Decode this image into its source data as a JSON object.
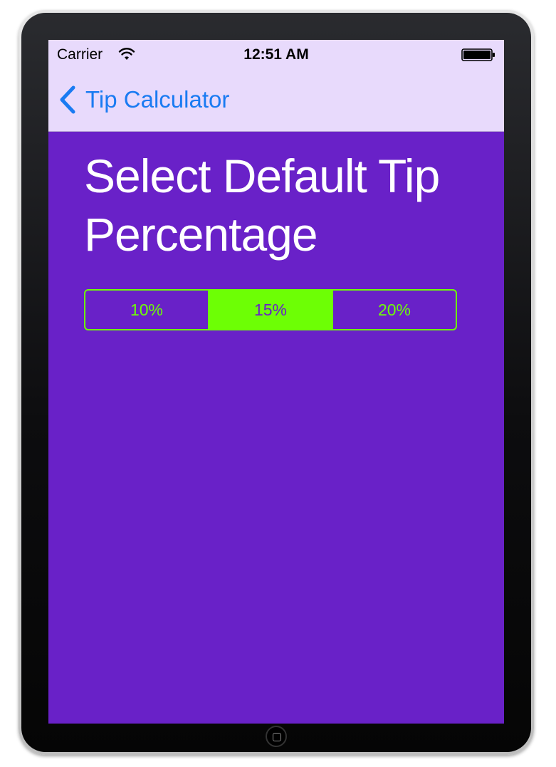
{
  "status_bar": {
    "carrier": "Carrier",
    "time": "12:51 AM",
    "wifi_icon": "wifi-icon",
    "battery_icon": "battery-icon"
  },
  "nav_bar": {
    "back_label": "Tip Calculator",
    "back_icon": "chevron-left-icon"
  },
  "main": {
    "heading": "Select Default Tip Percentage",
    "segments": [
      {
        "label": "10%",
        "selected": false
      },
      {
        "label": "15%",
        "selected": true
      },
      {
        "label": "20%",
        "selected": false
      }
    ]
  },
  "colors": {
    "background": "#6921c8",
    "bar_background": "#e8dafc",
    "tint_blue": "#1a7bf2",
    "segment_green": "#6dff05",
    "heading_text": "#ffffff"
  }
}
